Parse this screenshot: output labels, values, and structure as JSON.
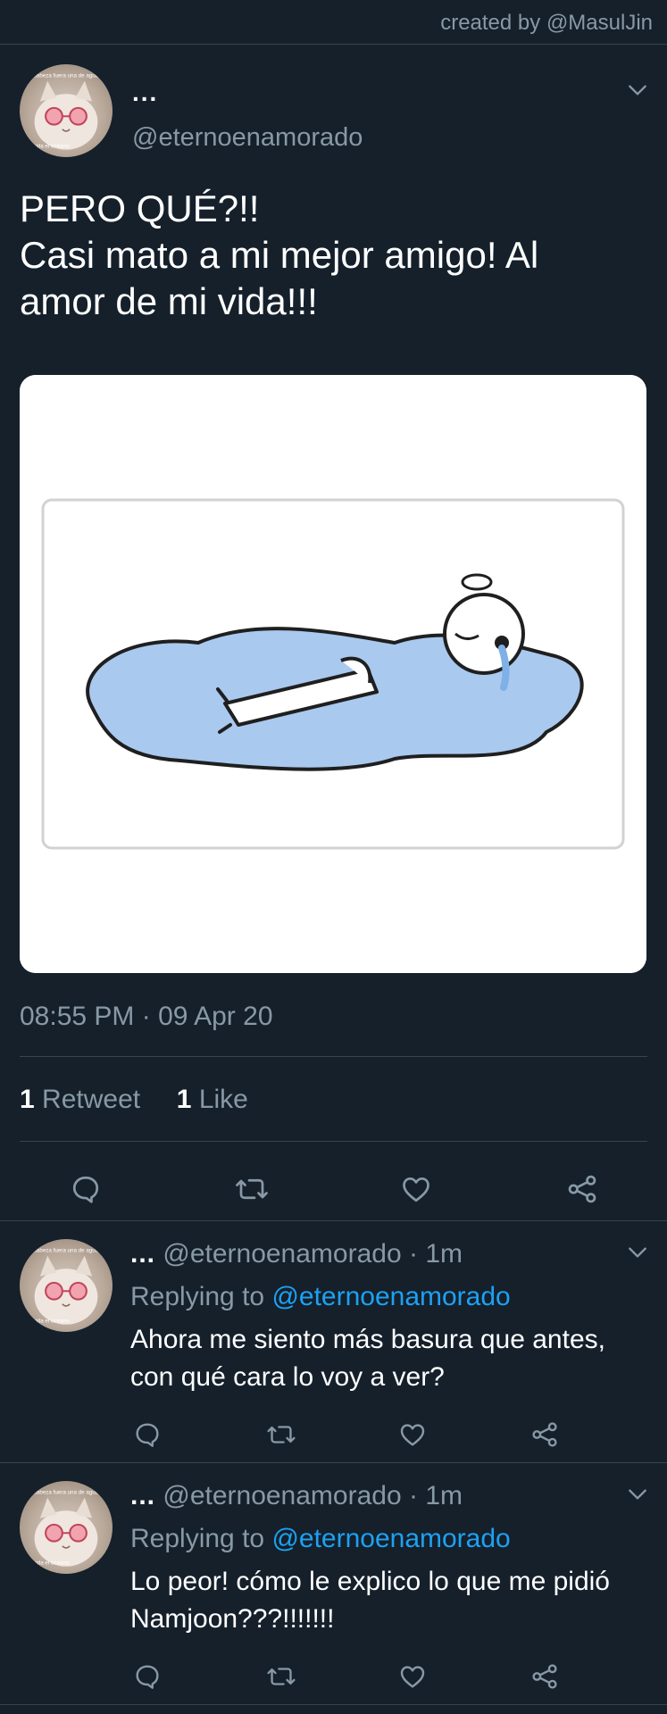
{
  "credit": "created by @MasulJin",
  "colors": {
    "background": "#15202b",
    "divider": "#38444d",
    "secondary_text": "#8899a6",
    "mention": "#1da1f2",
    "puddle": "#a9c9ef"
  },
  "main_tweet": {
    "name": "...",
    "handle": "@eternoenamorado",
    "text_lines": [
      "PERO QUÉ?!!",
      "Casi mato a mi mejor amigo! Al",
      "amor de mi vida!!!"
    ],
    "timestamp": "08:55 PM · 09 Apr 20",
    "retweet_count": "1",
    "retweet_label": "Retweet",
    "like_count": "1",
    "like_label": "Like",
    "actions": [
      "reply-icon",
      "retweet-icon",
      "like-icon",
      "share-icon"
    ]
  },
  "avatar": {
    "caption_top": "sabeza fuera una de agua",
    "caption_bottom": "vida el océano"
  },
  "replies": [
    {
      "name": "...",
      "handle": "@eternoenamorado",
      "time": "· 1m",
      "replying_label": "Replying to",
      "replying_to": "@eternoenamorado",
      "text_lines": [
        "Ahora me siento más basura que antes,",
        "con qué cara lo voy a ver?"
      ]
    },
    {
      "name": "...",
      "handle": "@eternoenamorado",
      "time": "· 1m",
      "replying_label": "Replying to",
      "replying_to": "@eternoenamorado",
      "text_lines": [
        "Lo peor! cómo le explico lo que me pidió",
        "Namjoon???!!!!!!!"
      ]
    }
  ]
}
